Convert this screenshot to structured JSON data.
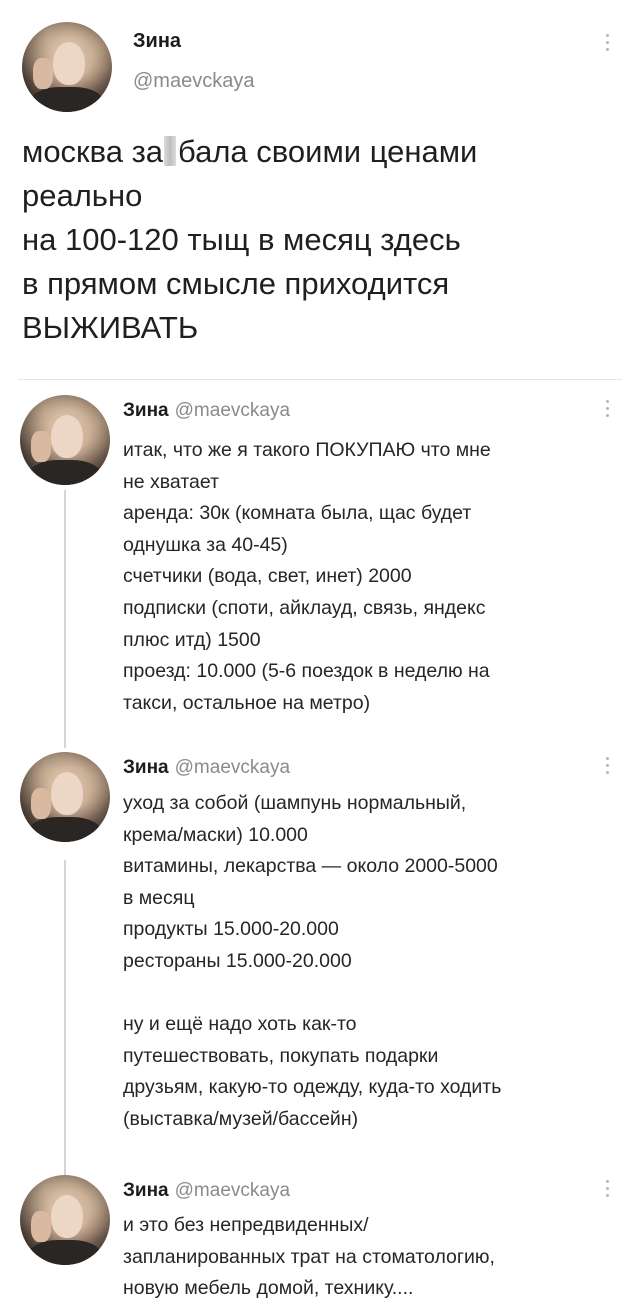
{
  "main_tweet": {
    "name": "Зина",
    "handle": "@maevckaya",
    "text_part1": "москва за",
    "text_part2": "бала своими ценами\nреально\nна 100-120 тыщ в месяц здесь\nв прямом смысле приходится\nВЫЖИВАТЬ"
  },
  "replies": [
    {
      "name": "Зина",
      "handle": "@maevckaya",
      "text": "итак, что же я такого ПОКУПАЮ что мне\nне хватает\nаренда: 30к (комната была, щас будет\nоднушка за 40-45)\nсчетчики (вода, свет, инет) 2000\nподписки (споти, айклауд, связь, яндекс\nплюс итд) 1500\nпроезд: 10.000 (5-6 поездок в неделю на\nтакси, остальное на метро)"
    },
    {
      "name": "Зина",
      "handle": "@maevckaya",
      "text": "уход за собой (шампунь нормальный,\nкрема/маски) 10.000\nвитамины, лекарства — около 2000-5000\nв месяц\nпродукты 15.000-20.000\nрестораны 15.000-20.000\n\nну и ещё надо хоть как-то\nпутешествовать, покупать подарки\nдрузьям, какую-то одежду, куда-то ходить\n(выставка/музей/бассейн)"
    },
    {
      "name": "Зина",
      "handle": "@maevckaya",
      "text": "и это без непредвиденных/\nзапланированных трат на стоматологию,\nновую мебель домой, технику...."
    }
  ]
}
